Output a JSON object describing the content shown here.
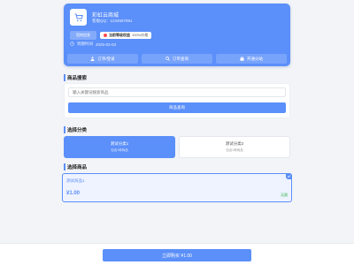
{
  "shop": {
    "name": "彩虹云商城",
    "qq_label": "客服QQ：1234567891",
    "badge_primary": "您的信息",
    "vip_label": "当前等级权益",
    "vip_value": "100%价格",
    "time_label": "到期时间",
    "time_value": "2025-02-03",
    "actions": [
      {
        "label": "订单/登录",
        "icon": "user-icon"
      },
      {
        "label": "订单查询",
        "icon": "search-icon"
      },
      {
        "label": "开通分站",
        "icon": "bag-icon"
      }
    ]
  },
  "search_section": {
    "title": "商品搜索",
    "placeholder": "输入关键词搜索商品",
    "button_label": "商品查询"
  },
  "category_section": {
    "title": "选择分类",
    "categories": [
      {
        "name": "测试分类1",
        "sub": "包含1种商品",
        "active": true
      },
      {
        "name": "测试分类2",
        "sub": "包含1种商品",
        "active": false
      }
    ]
  },
  "product_section": {
    "title": "选择商品",
    "product": {
      "name": "测试商品1",
      "price": "¥1.00",
      "stock": "无限"
    }
  },
  "bottom": {
    "buy_label": "立即购买 ¥1.00"
  },
  "colors": {
    "accent": "#5b8ff9",
    "stock": "#2fb344",
    "vip_dot": "#ff4d4f"
  }
}
